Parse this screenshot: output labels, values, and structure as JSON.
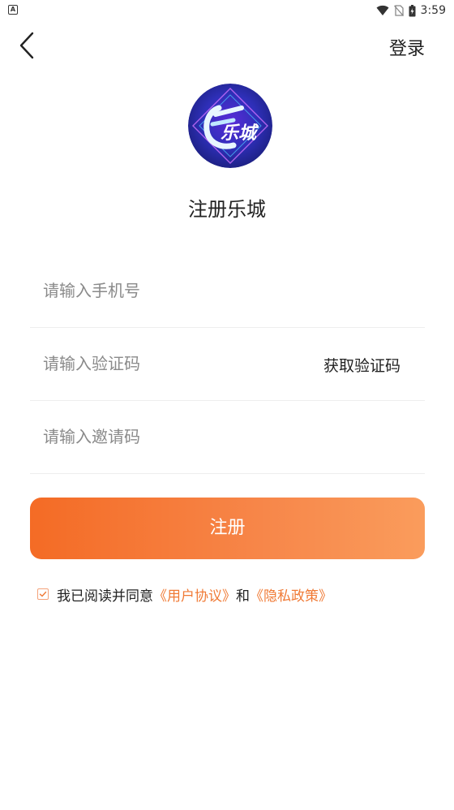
{
  "status_bar": {
    "left_icon_letter": "A",
    "time": "3:59"
  },
  "nav": {
    "login_label": "登录"
  },
  "logo": {
    "text": "乐城"
  },
  "title": "注册乐城",
  "form": {
    "phone_placeholder": "请输入手机号",
    "code_placeholder": "请输入验证码",
    "get_code_label": "获取验证码",
    "invite_placeholder": "请输入邀请码"
  },
  "register_label": "注册",
  "agreement": {
    "prefix": "我已阅读并同意",
    "user_agreement": "《用户协议》",
    "conjunction": "和",
    "privacy_policy": "《隐私政策》"
  },
  "colors": {
    "accent": "#f07a35",
    "button_start": "#f46b25",
    "button_end": "#fa9c5c"
  }
}
